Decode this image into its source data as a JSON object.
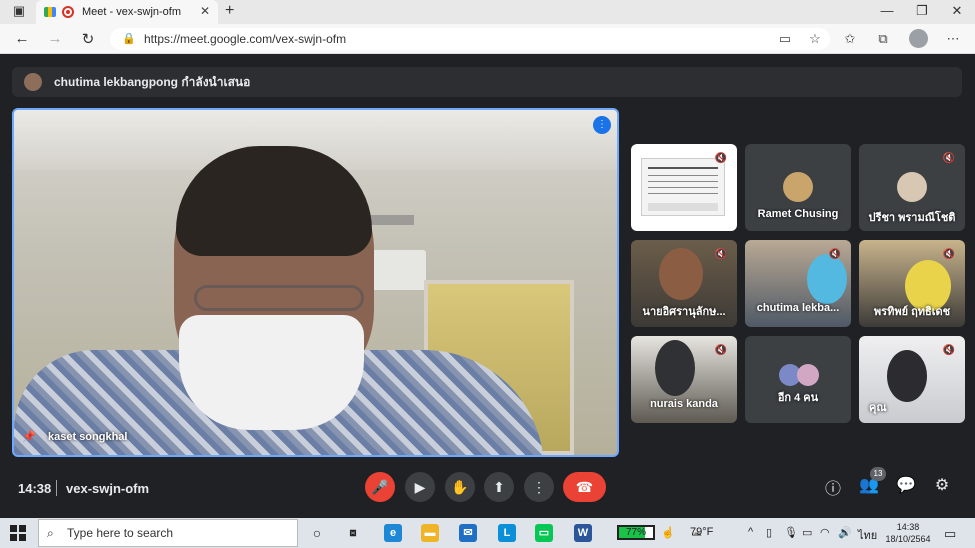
{
  "browser": {
    "tab_title": "Meet - vex-swjn-ofm",
    "new_tab": "+",
    "url": "https://meet.google.com/vex-swjn-ofm",
    "window_controls": [
      "—",
      "❐",
      "✕"
    ]
  },
  "meet": {
    "presenting_banner": "chutima lekbangpong กำลังนำเสนอ",
    "main_speaker": "kaset songkhal",
    "tiles": [
      {
        "label": "",
        "muted": true
      },
      {
        "label": "Ramet Chusing",
        "muted": false
      },
      {
        "label": "ปรีชา พรามณีโชติ",
        "muted": true
      },
      {
        "label": "นายอิศรานุลักษ...",
        "muted": true
      },
      {
        "label": "chutima lekba...",
        "muted": true
      },
      {
        "label": "พรทิพย์ ฤทธิเดช",
        "muted": true
      },
      {
        "label": "nurais kanda",
        "muted": true
      },
      {
        "label": "อีก 4 คน",
        "muted": false
      },
      {
        "label": "คุณ",
        "muted": true
      }
    ],
    "controls": {
      "time": "14:38",
      "meeting_code": "vex-swjn-ofm",
      "participant_count": "13"
    }
  },
  "taskbar": {
    "search_placeholder": "Type here to search",
    "battery": "77%",
    "battery_level": 0.77,
    "weather": "79°F",
    "language": "ไทย",
    "time": "14:38",
    "date": "18/10/2564"
  },
  "colors": {
    "meet_bg": "#202124",
    "tile_bg": "#3c4043",
    "danger": "#ea4335",
    "accent": "#1a73e8"
  }
}
